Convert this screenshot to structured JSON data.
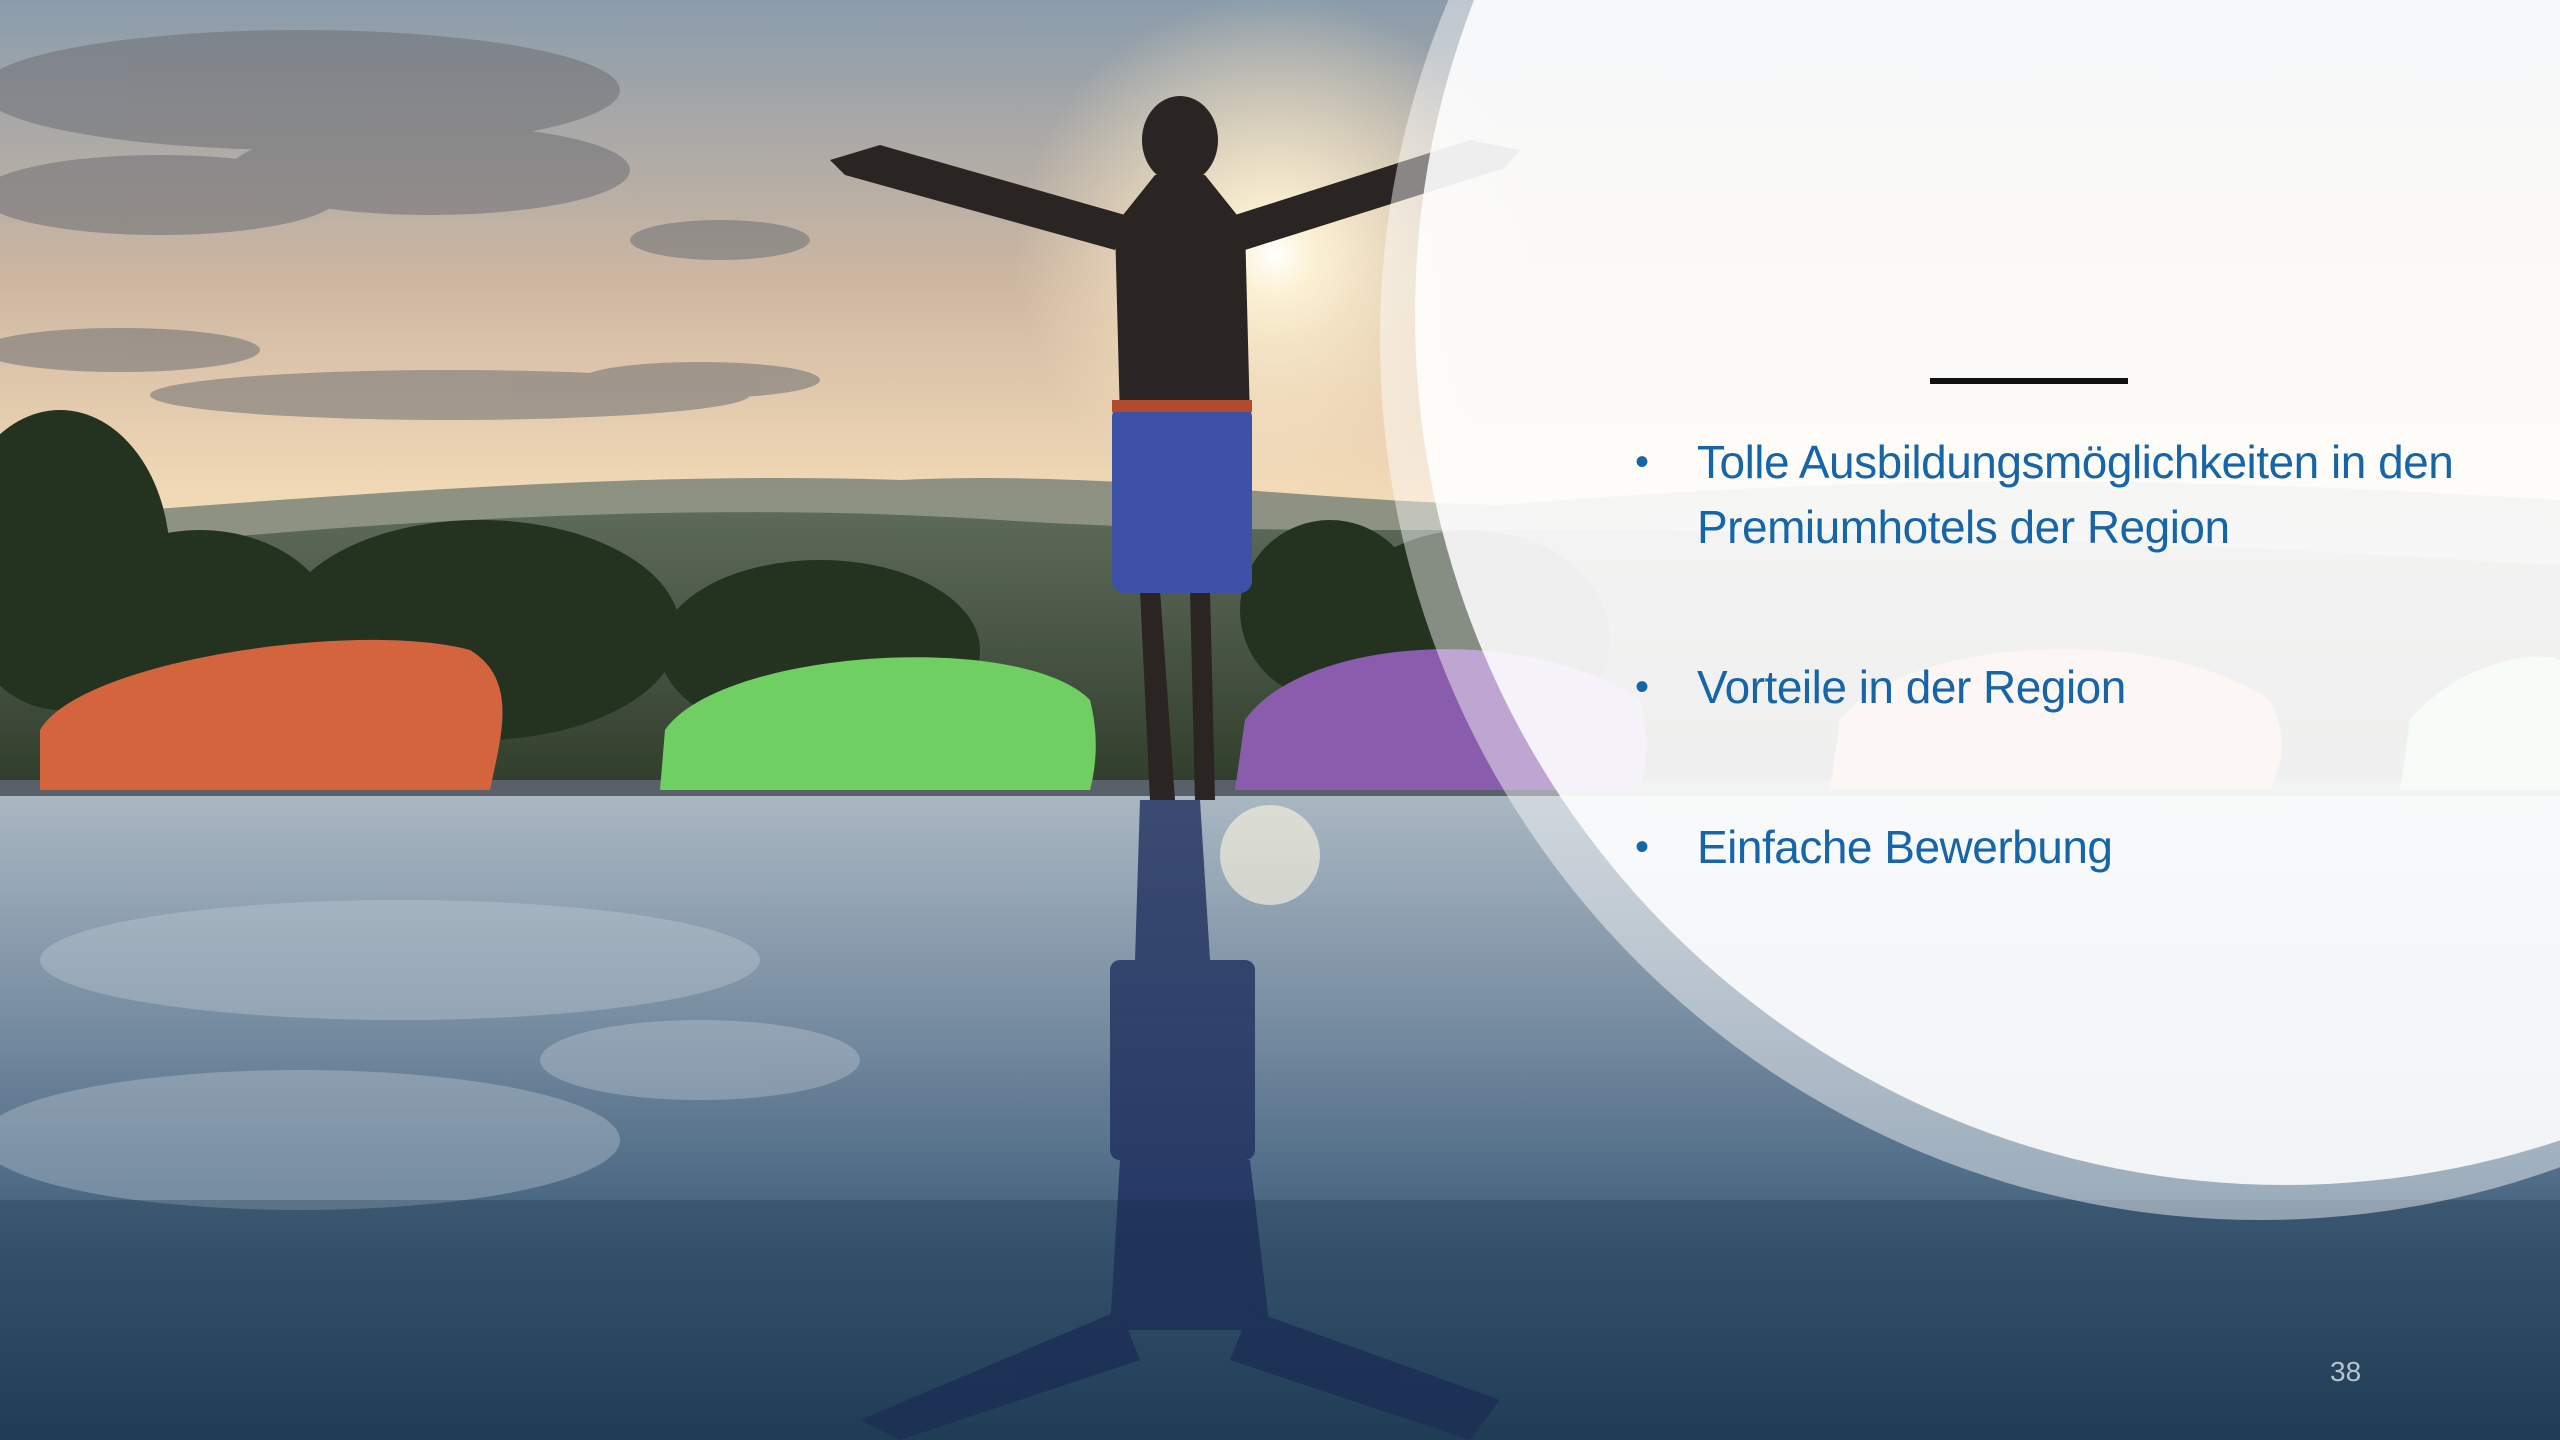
{
  "slide": {
    "bullets": [
      {
        "text": "Tolle Ausbildungsmöglichkeiten in den Premiumhotels der Region"
      },
      {
        "text": "Vorteile in der Region"
      },
      {
        "text": "Einfache Bewerbung"
      }
    ],
    "bullet_symbol": "•",
    "page_number": "38"
  },
  "colors": {
    "bullet_text": "#1565a8",
    "title_rule": "#111111",
    "page_number": "#b9c3cc"
  },
  "photo": {
    "subject": "man-arms-outstretched-infinity-pool-sunset"
  }
}
